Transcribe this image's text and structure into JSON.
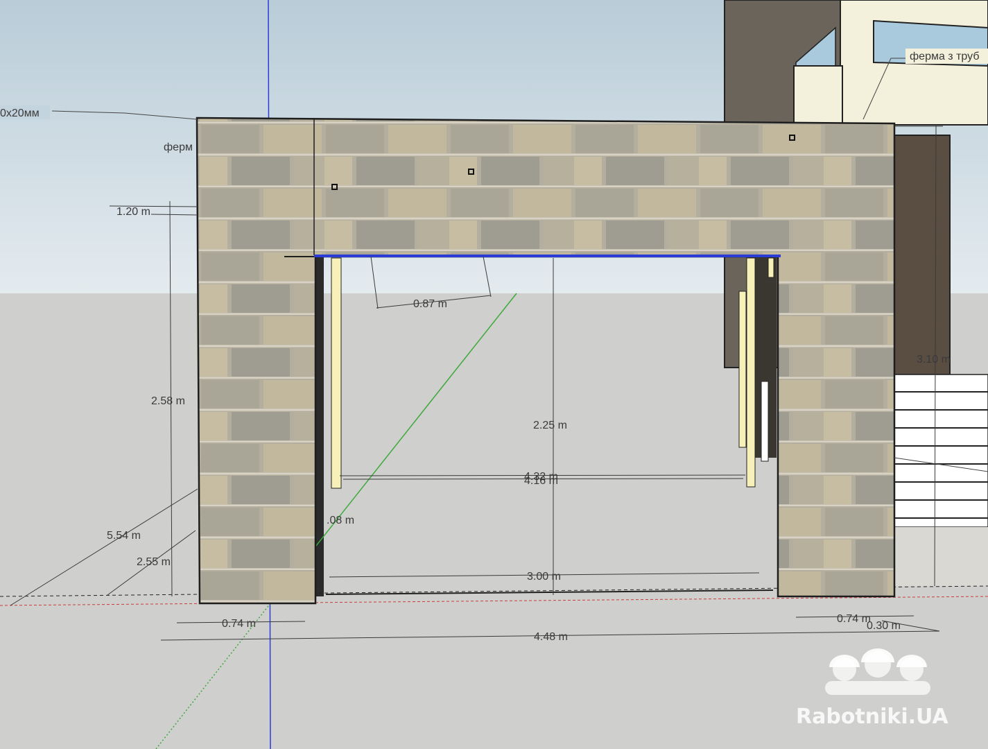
{
  "labels": {
    "left_top": "0x20мм",
    "left_mid": "ферм",
    "right_top": "ферма з труб"
  },
  "dimensions": {
    "d_120": "1.20 m",
    "d_258": "2.58 m",
    "d_554": "5.54 m",
    "d_255": "2.55 m",
    "d_074_left": "0.74 m",
    "d_448": "4.48 m",
    "d_087": "0.87 m",
    "d_225": "2.25 m",
    "d_432": "4.32 m",
    "d_416": "4.16 m",
    "d_small": ".08 m",
    "d_300": "3.00 m",
    "d_074_right": "0.74 m",
    "d_030": "0.30 m",
    "d_310": "3.10 m"
  },
  "watermark": "Rabotniki.UA",
  "colors": {
    "sky": "#cfdde6",
    "ground": "#cfcfcd",
    "blue_axis": "#2a3bd6",
    "green_axis": "#3caa3c",
    "red_axis": "#c83c3c",
    "wall_dark": "#6b645a"
  }
}
